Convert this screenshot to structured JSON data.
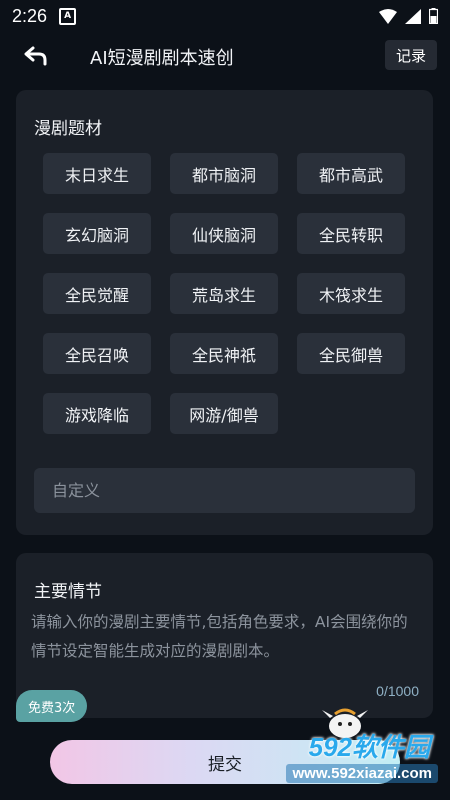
{
  "status_bar": {
    "time": "2:26",
    "notification_letter": "A"
  },
  "app_bar": {
    "title": "AI短漫剧剧本速创",
    "record_label": "记录"
  },
  "genre_card": {
    "title": "漫剧题材",
    "genres": [
      "末日求生",
      "都市脑洞",
      "都市高武",
      "玄幻脑洞",
      "仙侠脑洞",
      "全民转职",
      "全民觉醒",
      "荒岛求生",
      "木筏求生",
      "全民召唤",
      "全民神祇",
      "全民御兽",
      "游戏降临",
      "网游/御兽"
    ],
    "custom_placeholder": "自定义",
    "custom_value": ""
  },
  "plot_card": {
    "title": "主要情节",
    "placeholder": "请输入你的漫剧主要情节,包括角色要求，AI会围绕你的情节设定智能生成对应的漫剧剧本。",
    "counter": "0/1000"
  },
  "free_badge": "免费3次",
  "submit_label": "提交",
  "watermark": {
    "logo": "592软件园",
    "url": "www.592xiazai.com"
  }
}
